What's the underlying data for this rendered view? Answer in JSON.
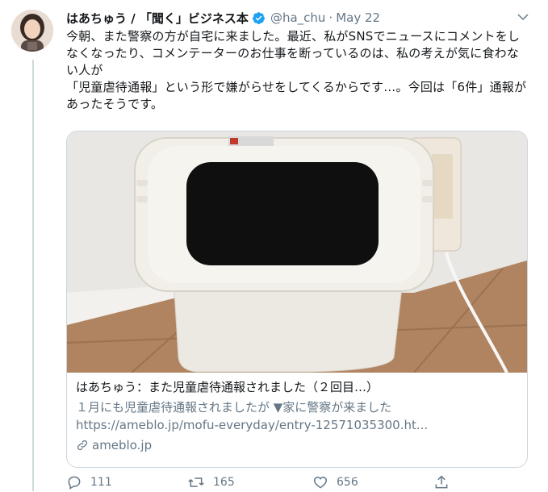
{
  "tweet": {
    "display_name": "はあちゅう / 「聞く」ビジネス本",
    "handle": "@ha_chu",
    "separator": "·",
    "date": "May 22",
    "text": "今朝、また警察の方が自宅に来ました。最近、私がSNSでニュースにコメントをしなくなったり、コメンテーターのお仕事を断っているのは、私の考えが気に食わない人が\n「児童虐待通報」という形で嫌がらせをしてくるからです…。今回は「6件」通報があったそうです。"
  },
  "card": {
    "title": "はあちゅう：また児童虐待通報されました（２回目…）",
    "description": "１月にも児童虐待通報されましたが ▼家に警察が来ました",
    "url": "https://ameblo.jp/mofu-everyday/entry-12571035300.ht...",
    "domain": "ameblo.jp"
  },
  "actions": {
    "replies": "111",
    "retweets": "165",
    "likes": "656"
  },
  "icons": {
    "verified": "verified-badge-icon",
    "caret": "chevron-down-icon",
    "link": "link-icon",
    "reply": "reply-icon",
    "retweet": "retweet-icon",
    "like": "heart-icon",
    "share": "share-icon"
  },
  "colors": {
    "verified_blue": "#1da1f2",
    "secondary_text": "#657786",
    "border": "#ccd6dd"
  }
}
